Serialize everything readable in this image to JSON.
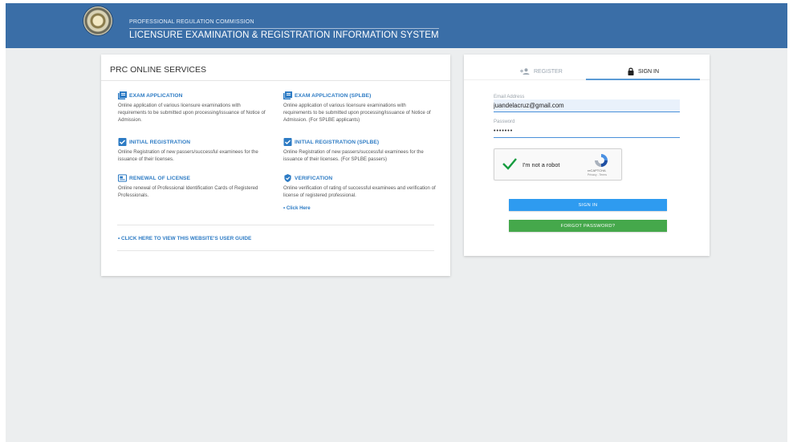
{
  "header": {
    "org_name": "PROFESSIONAL REGULATION COMMISSION",
    "system_name": "LICENSURE EXAMINATION & REGISTRATION INFORMATION SYSTEM"
  },
  "services": {
    "title": "PRC ONLINE SERVICES",
    "items": [
      {
        "label": "EXAM APPLICATION",
        "icon": "document-list-icon",
        "description": "Online application of various licensure examinations with requirements to be submitted upon processing/issuance of Notice of Admission."
      },
      {
        "label": "EXAM APPLICATION (SPLBE)",
        "icon": "document-list-icon",
        "description": "Online application of various licensure examinations with requirements to be submitted upon processing/issuance of Notice of Admission. (For SPLBE applicants)"
      },
      {
        "label": "INITIAL REGISTRATION",
        "icon": "checkbox-icon",
        "description": "Online Registration of new passers/successful examinees for the issuance of their licenses."
      },
      {
        "label": "INITIAL REGISTRATION (SPLBE)",
        "icon": "checkbox-icon",
        "description": "Online Registration of new passers/successful examinees for the issuance of their licenses. (For SPLBE passers)"
      },
      {
        "label": "RENEWAL OF LICENSE",
        "icon": "id-card-icon",
        "description": "Online renewal of Professional Identification Cards of Registered Professionals."
      },
      {
        "label": "VERIFICATION",
        "icon": "verified-badge-icon",
        "description": "Online verification of rating of successful examinees and verification of license of registered professional.",
        "link": "• Click Here"
      }
    ],
    "guide_link": "• CLICK HERE TO VIEW THIS WEBSITE'S USER GUIDE"
  },
  "login": {
    "tabs": {
      "register": "REGISTER",
      "signin": "SIGN IN"
    },
    "email_label": "Email Address",
    "email_value": "juandelacruz@gmail.com",
    "password_label": "Password",
    "password_value": "•••••••",
    "recaptcha": {
      "text": "I'm not a robot",
      "brand": "reCAPTCHA",
      "links": "Privacy - Terms"
    },
    "signin_button": "SIGN IN",
    "forgot_button": "FORGOT PASSWORD?"
  },
  "colors": {
    "header_bg": "#3a6ea7",
    "link_blue": "#2d7bc4",
    "signin_button": "#2e9bf0",
    "forgot_button": "#45a84b"
  }
}
